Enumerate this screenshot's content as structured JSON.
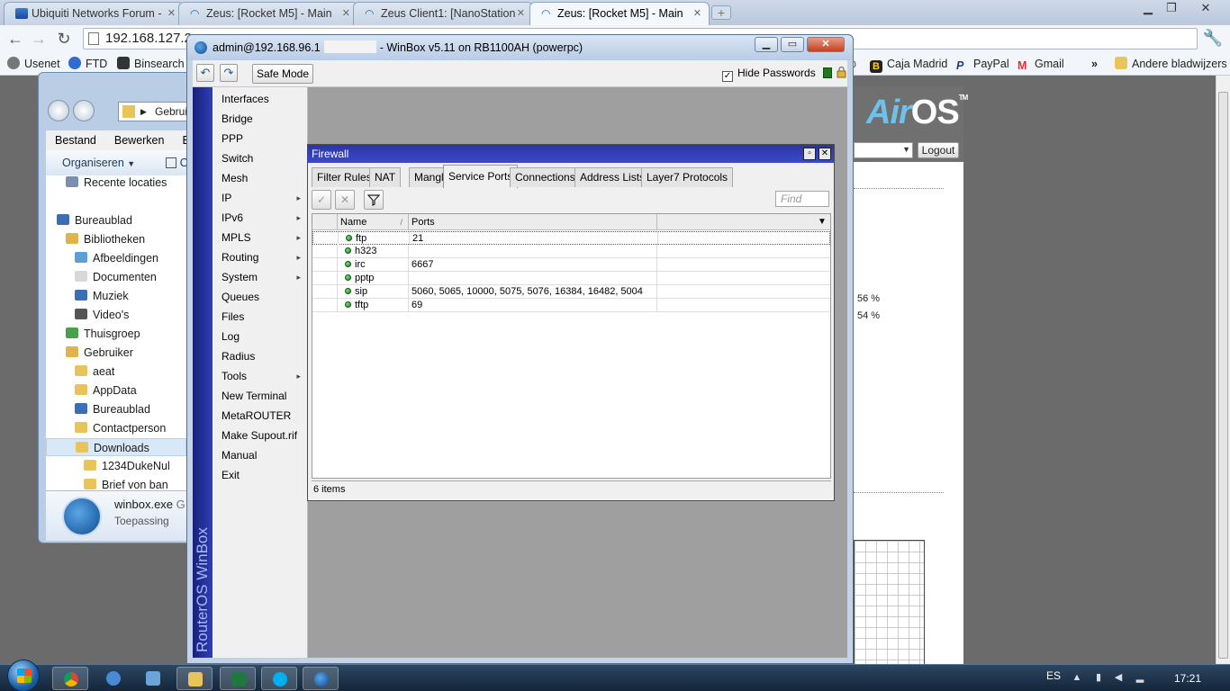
{
  "browser": {
    "tabs": [
      {
        "title": "Ubiquiti Networks Forum - ",
        "icon": "ubiquiti-icon",
        "active": false
      },
      {
        "title": "Zeus: [Rocket M5] - Main",
        "icon": "airos-wifi-icon",
        "active": false
      },
      {
        "title": "Zeus Client1: [NanoStation",
        "icon": "airos-wifi-icon",
        "active": false
      },
      {
        "title": "Zeus: [Rocket M5] - Main",
        "icon": "airos-wifi-icon",
        "active": true
      }
    ],
    "address": "192.168.127.2",
    "bookmarks_left": [
      "Usenet",
      "FTD",
      "Binsearch"
    ],
    "bookmarks_right": [
      "Caja Madrid",
      "PayPal",
      "Gmail"
    ],
    "other_bookmarks": "Andere bladwijzers",
    "more_chevron": "»"
  },
  "airos": {
    "logo_a": "Air",
    "logo_b": "OS",
    "tm": "TM",
    "logout": "Logout",
    "pct1": "56 %",
    "pct2": "54 %"
  },
  "explorer": {
    "path": "Gebruiker",
    "menu": [
      "Bestand",
      "Bewerken",
      "Beel"
    ],
    "organize": "Organiseren",
    "organize_caret": "▼",
    "cmd2": "O",
    "tree": [
      {
        "label": "Recente locaties",
        "color": "#7a8fb0"
      },
      {
        "label": "Bureaublad",
        "color": "#3a6fb5"
      },
      {
        "label": "Bibliotheken",
        "color": "#e0b44a"
      },
      {
        "label": "Afbeeldingen",
        "color": "#5aa0d6"
      },
      {
        "label": "Documenten",
        "color": "#d8d8d8"
      },
      {
        "label": "Muziek",
        "color": "#3a6fb5"
      },
      {
        "label": "Video's",
        "color": "#555555"
      },
      {
        "label": "Thuisgroep",
        "color": "#4aa04a"
      },
      {
        "label": "Gebruiker",
        "color": "#e0b44a"
      },
      {
        "label": "aeat",
        "color": "#e8c45a"
      },
      {
        "label": "AppData",
        "color": "#e8c45a"
      },
      {
        "label": "Bureaublad",
        "color": "#3a6fb5"
      },
      {
        "label": "Contactperson",
        "color": "#e8c45a"
      },
      {
        "label": "Downloads",
        "color": "#e8c45a"
      },
      {
        "label": "1234DukeNul",
        "color": "#e8c45a"
      },
      {
        "label": "Brief von ban",
        "color": "#e8c45a"
      }
    ],
    "details_name": "winbox.exe",
    "details_extra": "G",
    "details_type": "Toepassing"
  },
  "winbox": {
    "title_prefix": "admin@192.168.96.1",
    "title_suffix": "- WinBox v5.11 on RB1100AH (powerpc)",
    "undo": "↶",
    "redo": "↷",
    "safe_mode": "Safe Mode",
    "hide_passwords": "Hide Passwords",
    "hide_checked": "✓",
    "brand": "RouterOS WinBox",
    "menu": [
      {
        "label": "Interfaces",
        "sub": ""
      },
      {
        "label": "Bridge",
        "sub": ""
      },
      {
        "label": "PPP",
        "sub": ""
      },
      {
        "label": "Switch",
        "sub": ""
      },
      {
        "label": "Mesh",
        "sub": ""
      },
      {
        "label": "IP",
        "sub": "▸"
      },
      {
        "label": "IPv6",
        "sub": "▸"
      },
      {
        "label": "MPLS",
        "sub": "▸"
      },
      {
        "label": "Routing",
        "sub": "▸"
      },
      {
        "label": "System",
        "sub": "▸"
      },
      {
        "label": "Queues",
        "sub": ""
      },
      {
        "label": "Files",
        "sub": ""
      },
      {
        "label": "Log",
        "sub": ""
      },
      {
        "label": "Radius",
        "sub": ""
      },
      {
        "label": "Tools",
        "sub": "▸"
      },
      {
        "label": "New Terminal",
        "sub": ""
      },
      {
        "label": "MetaROUTER",
        "sub": ""
      },
      {
        "label": "Make Supout.rif",
        "sub": ""
      },
      {
        "label": "Manual",
        "sub": ""
      },
      {
        "label": "Exit",
        "sub": ""
      }
    ]
  },
  "firewall": {
    "title": "Firewall",
    "tabs": [
      "Filter Rules",
      "NAT",
      "Mangle",
      "Service Ports",
      "Connections",
      "Address Lists",
      "Layer7 Protocols"
    ],
    "active_tab": "Service Ports",
    "find_placeholder": "Find",
    "columns": {
      "name": "Name",
      "ports": "Ports",
      "sort_mark": "/"
    },
    "rows": [
      {
        "name": "ftp",
        "ports": "21"
      },
      {
        "name": "h323",
        "ports": ""
      },
      {
        "name": "irc",
        "ports": "6667"
      },
      {
        "name": "pptp",
        "ports": ""
      },
      {
        "name": "sip",
        "ports": "5060, 5065, 10000, 5075, 5076, 16384, 16482, 5004"
      },
      {
        "name": "tftp",
        "ports": "69"
      }
    ],
    "status": "6 items"
  },
  "taskbar": {
    "lang": "ES",
    "time": "17:21"
  }
}
